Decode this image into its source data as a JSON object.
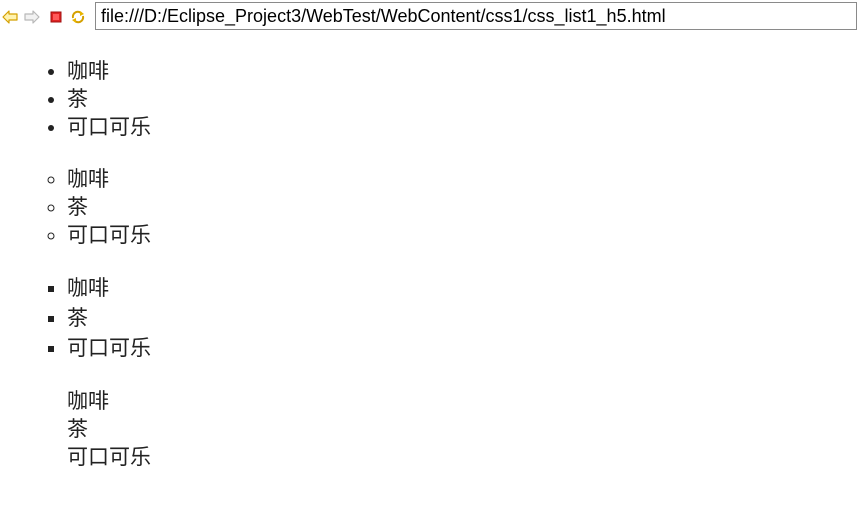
{
  "toolbar": {
    "back_icon": "back-arrow-icon",
    "forward_icon": "forward-arrow-icon",
    "stop_icon": "stop-icon",
    "refresh_icon": "refresh-icon",
    "url": "file:///D:/Eclipse_Project3/WebTest/WebContent/css1/css_list1_h5.html",
    "colors": {
      "back_arrow": "#e8b400",
      "forward_arrow_disabled": "#c8c8c8",
      "stop": "#d42020",
      "refresh": "#e8b400"
    }
  },
  "lists": [
    {
      "style": "disc",
      "items": [
        "咖啡",
        "茶",
        "可口可乐"
      ]
    },
    {
      "style": "circle",
      "items": [
        "咖啡",
        "茶",
        "可口可乐"
      ]
    },
    {
      "style": "square",
      "items": [
        "咖啡",
        "茶",
        "可口可乐"
      ]
    },
    {
      "style": "none",
      "items": [
        "咖啡",
        "茶",
        "可口可乐"
      ]
    }
  ]
}
